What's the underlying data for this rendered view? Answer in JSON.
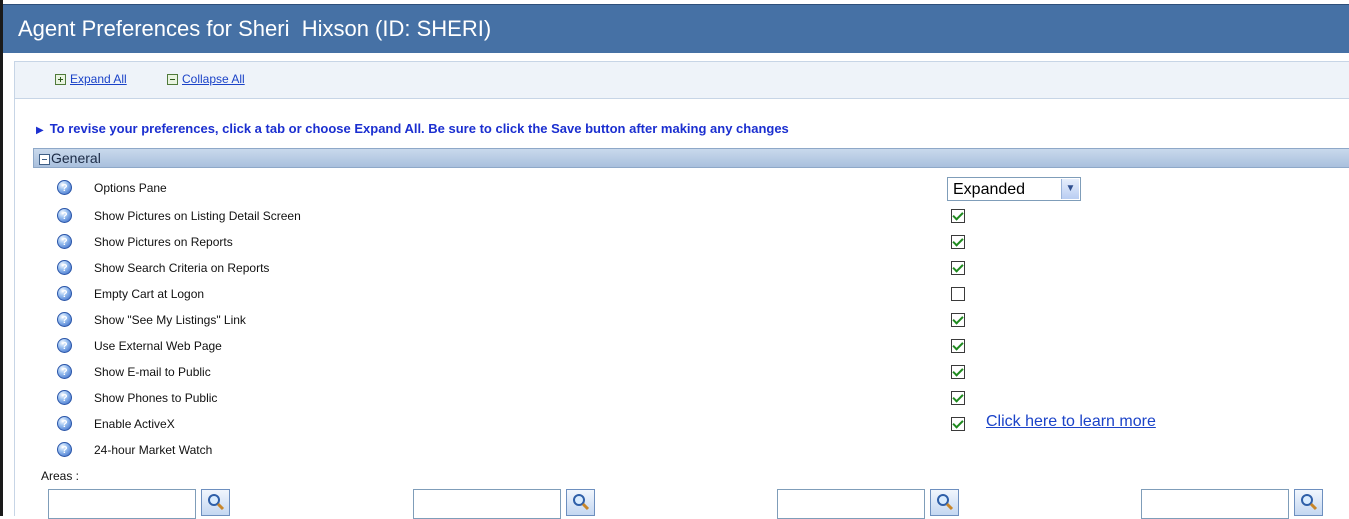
{
  "header": {
    "title": "Agent Preferences for Sheri  Hixson (ID: SHERI)"
  },
  "toolbar": {
    "expand_all": "Expand All",
    "collapse_all": "Collapse All"
  },
  "instruction": "To revise your preferences, click a tab or choose Expand All. Be sure to click the Save button after making any changes",
  "section": {
    "title": "General",
    "rows": [
      {
        "label": "Options Pane",
        "control": "select",
        "value": "Expanded"
      },
      {
        "label": "Show Pictures on Listing Detail Screen",
        "control": "checkbox",
        "checked": true
      },
      {
        "label": "Show Pictures on Reports",
        "control": "checkbox",
        "checked": true
      },
      {
        "label": "Show Search Criteria on Reports",
        "control": "checkbox",
        "checked": true
      },
      {
        "label": "Empty Cart at Logon",
        "control": "checkbox",
        "checked": false
      },
      {
        "label": "Show \"See My Listings\" Link",
        "control": "checkbox",
        "checked": true
      },
      {
        "label": "Use External Web Page",
        "control": "checkbox",
        "checked": true
      },
      {
        "label": "Show E-mail to Public",
        "control": "checkbox",
        "checked": true
      },
      {
        "label": "Show Phones to Public",
        "control": "checkbox",
        "checked": true
      },
      {
        "label": "Enable ActiveX",
        "control": "checkbox",
        "checked": true,
        "link": "Click here to learn more"
      },
      {
        "label": "24-hour Market Watch",
        "control": "none"
      }
    ],
    "areas_label": "Areas :",
    "areas": [
      "",
      "",
      "",
      ""
    ]
  },
  "colors": {
    "title_bar": "#4671a5",
    "link": "#1b43c8",
    "instruction": "#1b2fd0",
    "check": "#1f8a1f"
  },
  "icons": [
    "plus-box-icon",
    "minus-box-icon",
    "help-icon",
    "chevron-down-icon",
    "magnifier-icon",
    "arrow-right-icon"
  ]
}
